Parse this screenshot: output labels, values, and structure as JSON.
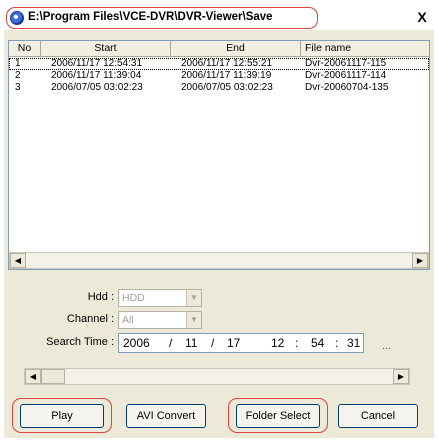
{
  "window": {
    "title": "E:\\Program Files\\VCE-DVR\\DVR-Viewer\\Save",
    "close_label": "X"
  },
  "listview": {
    "columns": [
      "No",
      "Start",
      "End",
      "File name"
    ],
    "rows": [
      {
        "no": "1",
        "start": "2006/11/17  12:54:31",
        "end": "2006/11/17  12:55:21",
        "file": "Dvr-20061117-115"
      },
      {
        "no": "2",
        "start": "2006/11/17  11:39:04",
        "end": "2006/11/17  11:39:19",
        "file": "Dvr-20061117-114"
      },
      {
        "no": "3",
        "start": "2006/07/05  03:02:23",
        "end": "2006/07/05  03:02:23",
        "file": "Dvr-20060704-135"
      }
    ]
  },
  "form": {
    "hdd_label": "Hdd :",
    "hdd_value": "HDD",
    "channel_label": "Channel :",
    "channel_value": "All",
    "search_time_label": "Search Time :",
    "search_time": {
      "year": "2006",
      "sep1": "/",
      "month": "11",
      "sep2": "/",
      "day": "17",
      "hour": "12",
      "sep3": ":",
      "minute": "54",
      "sep4": ":",
      "second": "31"
    },
    "ellipsis": "..."
  },
  "buttons": {
    "play": "Play",
    "avi_convert": "AVI Convert",
    "folder_select": "Folder Select",
    "cancel": "Cancel"
  },
  "icons": {
    "app": "app-globe-icon",
    "scroll_left": "scroll-left-arrow-icon",
    "scroll_right": "scroll-right-arrow-icon",
    "dropdown": "chevron-down-icon"
  },
  "colors": {
    "highlight": "#e0443a",
    "window_bg": "#ece9d8",
    "button_border": "#003c74"
  }
}
